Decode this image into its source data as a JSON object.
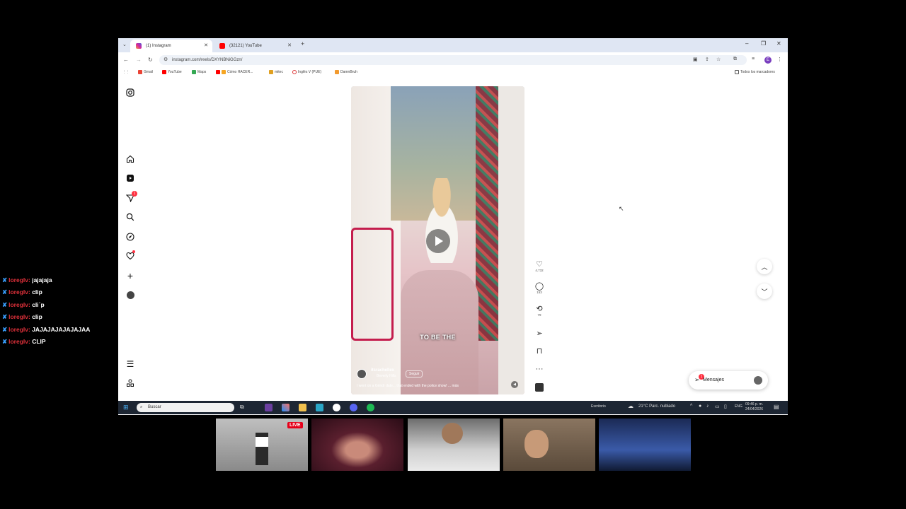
{
  "browser": {
    "tabs": [
      {
        "label": "(1) Instagram",
        "active": true
      },
      {
        "label": "(32121) YouTube",
        "active": false
      }
    ],
    "url": "instagram.com/reels/DXYNBNiGGzn/",
    "profile_initial": "E",
    "bookmarks": [
      "Gmail",
      "YouTube",
      "Maps",
      "Cómo HACER...",
      "mitec",
      "Inglés V (PUE)",
      "DamnBruh"
    ],
    "all_bookmarks_label": "Todos los marcadores"
  },
  "instagram": {
    "notifications_badge": "1",
    "reel": {
      "subtitle": "TO BE THE",
      "author": "itsrachellex",
      "location": "Beverly Hills",
      "follow_label": "Seguir",
      "caption": "I went on a Grindr date... that ended with the police show! ... más"
    },
    "actions": {
      "likes": "4,732",
      "comments": "153",
      "reposts": "79"
    },
    "messages": {
      "label": "Mensajes",
      "badge": "1"
    }
  },
  "taskbar": {
    "search_placeholder": "Buscar",
    "desktop_label": "Escritorio",
    "weather": "21°C  Parc. nublado",
    "lang": "ENG",
    "time": "09:46 p. m.",
    "date": "24/04/2026"
  },
  "chat": [
    {
      "user": "loreglv:",
      "msg": "jajajaja"
    },
    {
      "user": "loreglv:",
      "msg": "clip"
    },
    {
      "user": "loreglv:",
      "msg": "cli´p"
    },
    {
      "user": "loreglv:",
      "msg": "clip"
    },
    {
      "user": "loreglv:",
      "msg": "JAJAJAJAJAJAJAA"
    },
    {
      "user": "loreglv:",
      "msg": "CLIP"
    }
  ],
  "live_badge": "LIVE",
  "colors": {
    "instagram_red": "#ff3040",
    "chat_user": "#e0303a",
    "live": "#e5001a",
    "taskbar": "#1d2633"
  }
}
